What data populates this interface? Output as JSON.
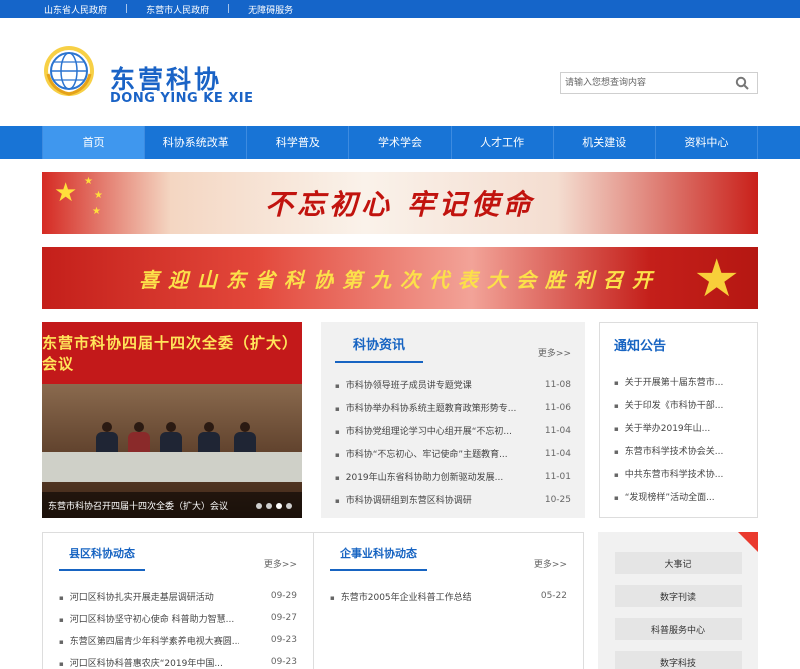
{
  "topbar": {
    "links": [
      "山东省人民政府",
      "东营市人民政府",
      "无障碍服务"
    ],
    "separator": "|"
  },
  "brand": {
    "name_cn": "东营科协",
    "name_en": "DONG YING KE XIE"
  },
  "search": {
    "placeholder": "请输入您想查询内容"
  },
  "nav": {
    "items": [
      "首页",
      "科协系统改革",
      "科学普及",
      "学术学会",
      "人才工作",
      "机关建设",
      "资料中心"
    ]
  },
  "banners": {
    "banner1": "不忘初心 牢记使命",
    "banner2": "喜迎山东省科协第九次代表大会胜利召开"
  },
  "slider": {
    "photo_title": "东营市科协四届十四次全委（扩大）会议",
    "caption": "东营市科协召开四届十四次全委（扩大）会议"
  },
  "news": {
    "title": "科协资讯",
    "more": "更多>>",
    "items": [
      {
        "title": "市科协领导班子成员讲专题党课",
        "date": "11-08"
      },
      {
        "title": "市科协举办科协系统主题教育政策形势专...",
        "date": "11-06"
      },
      {
        "title": "市科协党组理论学习中心组开展“不忘初...",
        "date": "11-04"
      },
      {
        "title": "市科协“不忘初心、牢记使命”主题教育...",
        "date": "11-04"
      },
      {
        "title": "2019年山东省科协助力创新驱动发展...",
        "date": "11-01"
      },
      {
        "title": "市科协调研组到东营区科协调研",
        "date": "10-25"
      }
    ]
  },
  "notice": {
    "title": "通知公告",
    "items": [
      "关于开展第十届东营市...",
      "关于印发《市科协干部...",
      "关于举办2019年山...",
      "东营市科学技术协会关...",
      "中共东营市科学技术协...",
      "“发现榜样”活动全面..."
    ]
  },
  "county": {
    "title": "县区科协动态",
    "more": "更多>>",
    "items": [
      {
        "title": "河口区科协扎实开展走基层调研活动",
        "date": "09-29"
      },
      {
        "title": "河口区科协坚守初心使命 科普助力智慧...",
        "date": "09-27"
      },
      {
        "title": "东营区第四届青少年科学素养电视大赛圆...",
        "date": "09-23"
      },
      {
        "title": "河口区科协科普惠农庆“2019年中国...",
        "date": "09-23"
      }
    ]
  },
  "enterprise": {
    "title": "企事业科协动态",
    "more": "更多>>",
    "items": [
      {
        "title": "东营市2005年企业科普工作总结",
        "date": "05-22"
      }
    ]
  },
  "side": {
    "buttons": [
      "大事记",
      "数字刊读",
      "科普服务中心",
      "数字科技"
    ]
  },
  "colors": {
    "primary": "#1874d6",
    "topbar": "#1565c9",
    "title_blue": "#1764c2",
    "banner_red": "#c41f1a"
  }
}
